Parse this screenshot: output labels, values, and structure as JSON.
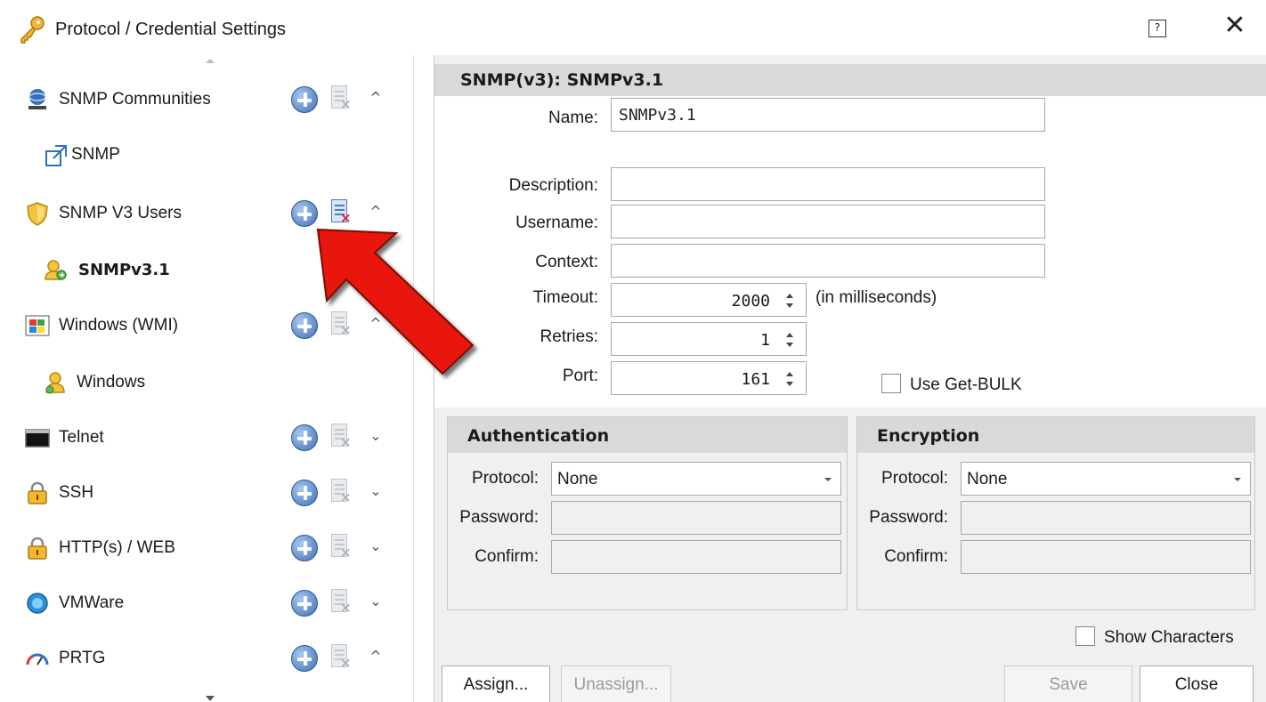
{
  "window": {
    "title": "Protocol / Credential Settings",
    "app_icon": "key-icon",
    "help_icon": "help-icon",
    "close_icon": "close-icon"
  },
  "tree": {
    "items": [
      {
        "label": "SNMP Communities",
        "icon": "network-icon",
        "level": 0,
        "expanded": true,
        "chevron": "^"
      },
      {
        "label": "SNMP",
        "icon": "shortcut-icon",
        "level": 1
      },
      {
        "label": "SNMP V3 Users",
        "icon": "shield-icon",
        "level": 0,
        "expanded": true,
        "chevron": "^"
      },
      {
        "label": "SNMPv3.1",
        "icon": "user-key-icon",
        "level": 1,
        "selected": true
      },
      {
        "label": "Windows (WMI)",
        "icon": "windows-icon",
        "level": 0,
        "expanded": true,
        "chevron": "^"
      },
      {
        "label": "Windows",
        "icon": "user-key-icon",
        "level": 1
      },
      {
        "label": "Telnet",
        "icon": "terminal-icon",
        "level": 0,
        "expanded": false,
        "chevron": "v"
      },
      {
        "label": "SSH",
        "icon": "lock-icon",
        "level": 0,
        "expanded": false,
        "chevron": "v"
      },
      {
        "label": "HTTP(s) / WEB",
        "icon": "lock-icon",
        "level": 0,
        "expanded": false,
        "chevron": "v"
      },
      {
        "label": "VMWare",
        "icon": "globe-icon",
        "level": 0,
        "expanded": false,
        "chevron": "v"
      },
      {
        "label": "PRTG",
        "icon": "gauge-icon",
        "level": 0,
        "expanded": true,
        "chevron": "^"
      }
    ]
  },
  "form": {
    "header": "SNMP(v3): SNMPv3.1",
    "name_label": "Name:",
    "name_value": "SNMPv3.1",
    "description_label": "Description:",
    "description_value": "",
    "username_label": "Username:",
    "username_value": "",
    "context_label": "Context:",
    "context_value": "",
    "timeout_label": "Timeout:",
    "timeout_value": "2000",
    "timeout_unit": "(in milliseconds)",
    "retries_label": "Retries:",
    "retries_value": "1",
    "port_label": "Port:",
    "port_value": "161",
    "getbulk_label": "Use Get-BULK",
    "getbulk_checked": false
  },
  "authentication": {
    "title": "Authentication",
    "protocol_label": "Protocol:",
    "protocol_value": "None",
    "password_label": "Password:",
    "confirm_label": "Confirm:"
  },
  "encryption": {
    "title": "Encryption",
    "protocol_label": "Protocol:",
    "protocol_value": "None",
    "password_label": "Password:",
    "confirm_label": "Confirm:"
  },
  "show_characters_label": "Show Characters",
  "buttons": {
    "assign": "Assign...",
    "unassign": "Unassign...",
    "save": "Save",
    "close": "Close"
  },
  "colors": {
    "annotation_arrow": "#e8140c",
    "header_bg": "#d9d9d9",
    "panel_bg": "#f0f0f0"
  }
}
